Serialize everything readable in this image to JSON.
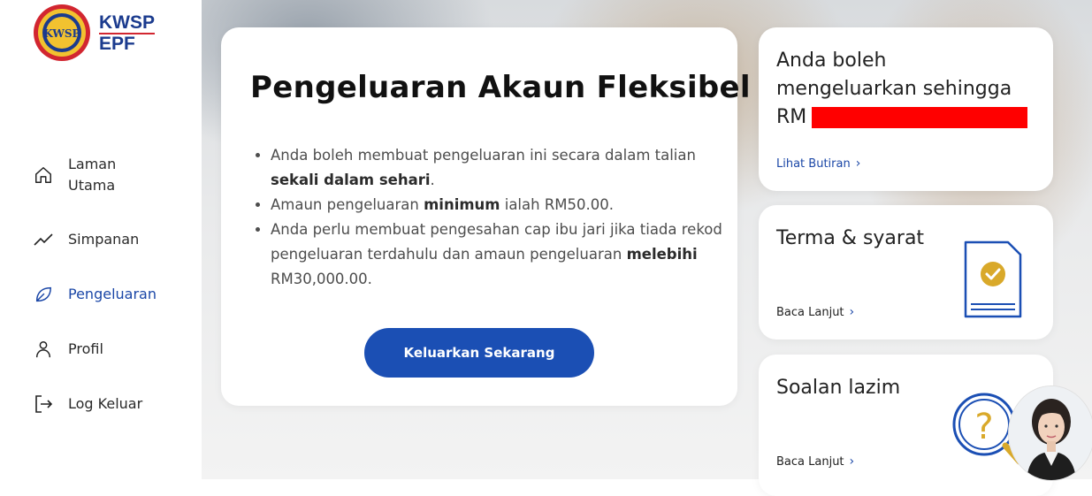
{
  "brand": {
    "line1": "KWSP",
    "line2": "EPF",
    "seal_text": "KWSP"
  },
  "nav": [
    {
      "label": "Laman\nUtama",
      "icon": "home-icon"
    },
    {
      "label": "Simpanan",
      "icon": "trend-icon"
    },
    {
      "label": "Pengeluaran",
      "icon": "leaf-icon",
      "active": true
    },
    {
      "label": "Profil",
      "icon": "user-icon"
    },
    {
      "label": "Log Keluar",
      "icon": "logout-icon"
    }
  ],
  "main": {
    "title": "Pengeluaran Akaun Fleksibel",
    "bullets": [
      {
        "pre": "Anda boleh membuat pengeluaran ini secara dalam talian ",
        "bold": "sekali dalam sehari",
        "post": "."
      },
      {
        "pre": "Amaun pengeluaran ",
        "bold": "minimum",
        "post": " ialah RM50.00."
      },
      {
        "pre": "Anda perlu membuat pengesahan cap ibu jari jika tiada rekod pengeluaran terdahulu dan amaun pengeluaran ",
        "bold": "melebihi",
        "post": " RM30,000.00."
      }
    ],
    "cta": "Keluarkan Sekarang"
  },
  "cards": {
    "limit": {
      "title_line1": "Anda boleh",
      "title_line2": "mengeluarkan sehingga",
      "currency": "RM",
      "link": "Lihat Butiran"
    },
    "terms": {
      "title": "Terma & syarat",
      "link": "Baca Lanjut"
    },
    "faq": {
      "title": "Soalan lazim",
      "link": "Baca Lanjut"
    }
  },
  "colors": {
    "brand_blue": "#1b4fb4",
    "accent_gold": "#d9a92a",
    "redaction": "#ff0000"
  }
}
